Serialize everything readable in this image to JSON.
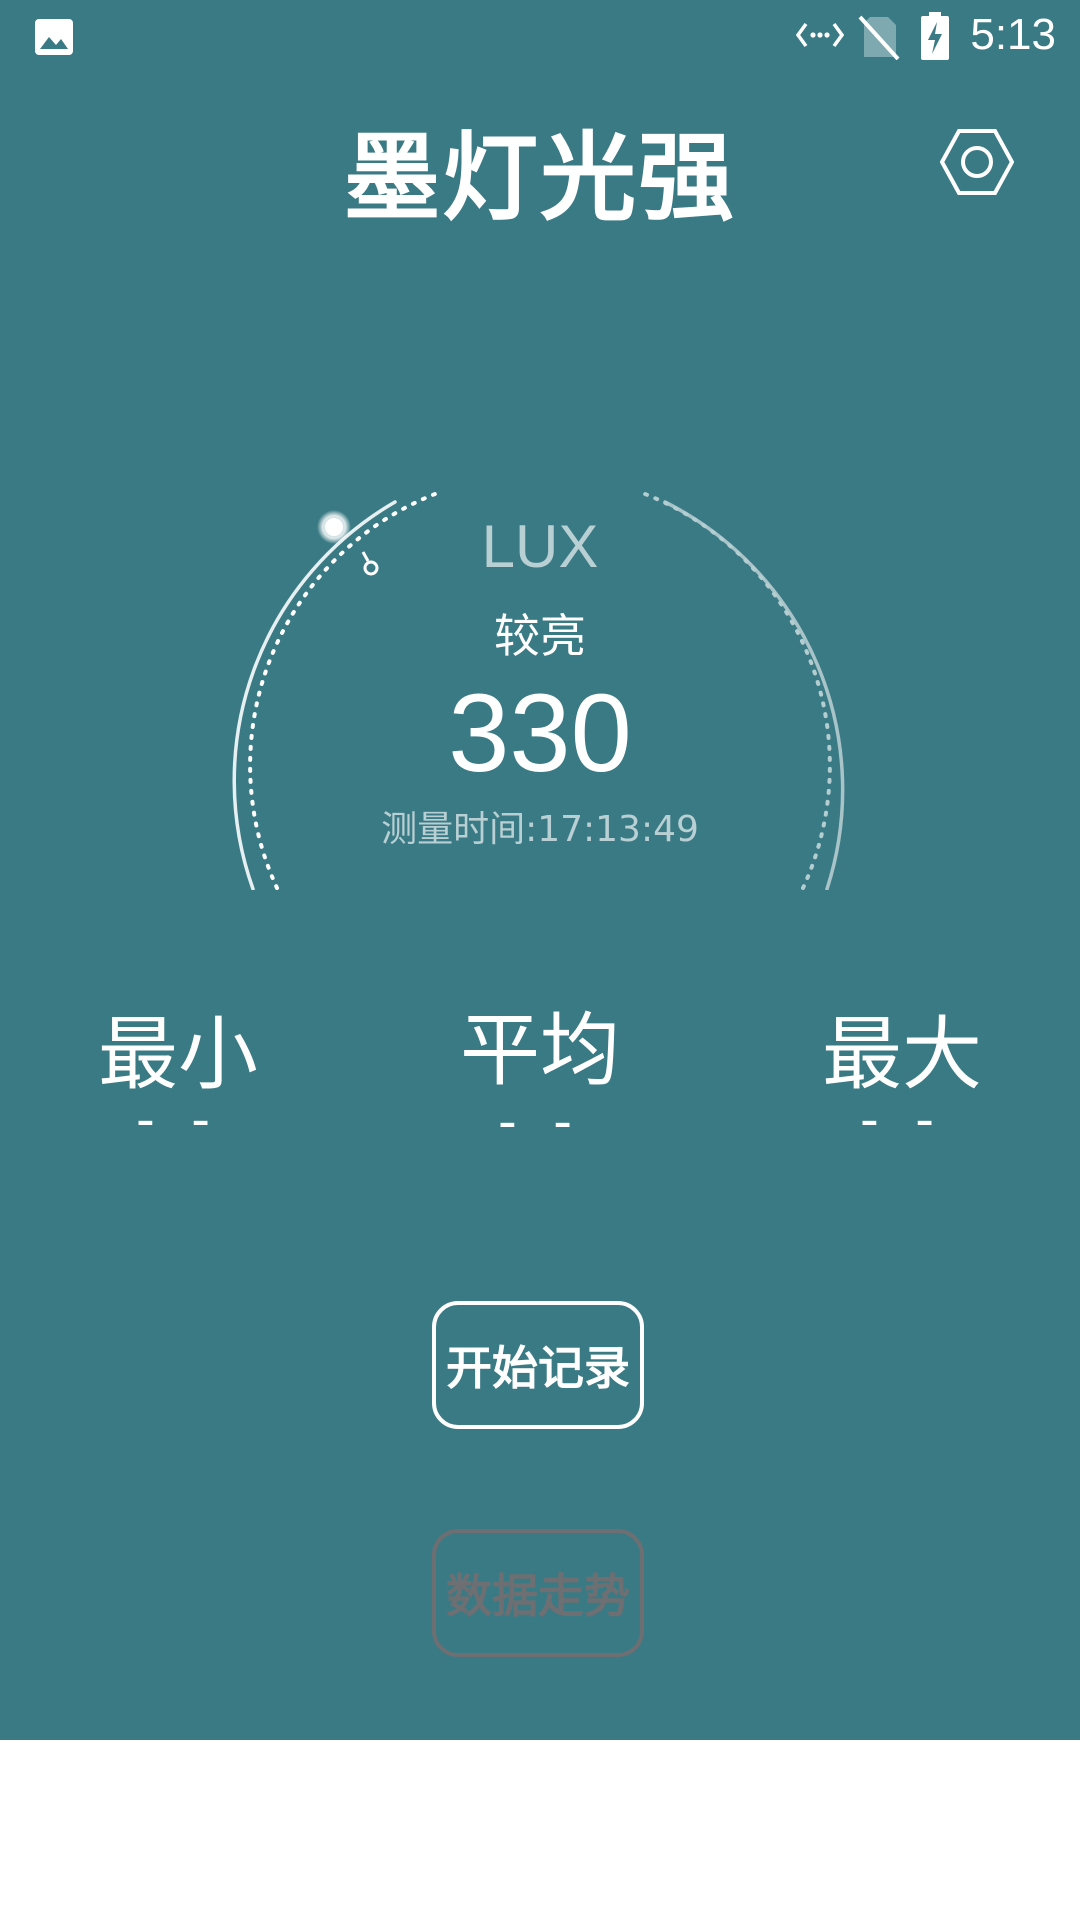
{
  "status_bar": {
    "time": "5:13",
    "icons": [
      "image-icon",
      "data-transfer-icon",
      "no-sim-icon",
      "battery-charging-icon"
    ]
  },
  "header": {
    "title": "墨灯光强",
    "settings_icon": "hexagon-settings-icon"
  },
  "gauge": {
    "unit": "LUX",
    "level": "较亮",
    "value": "330",
    "measure_time": "测量时间:17:13:49"
  },
  "stats": {
    "min": {
      "label": "最小",
      "value": "- -"
    },
    "avg": {
      "label": "平均",
      "value": "- -"
    },
    "max": {
      "label": "最大",
      "value": "- -"
    }
  },
  "buttons": {
    "start": "开始记录",
    "trend": "数据走势"
  },
  "colors": {
    "background": "#3a7a84",
    "text": "#ffffff",
    "muted_text": "#b8cfd3",
    "disabled": "#6d6f72"
  }
}
